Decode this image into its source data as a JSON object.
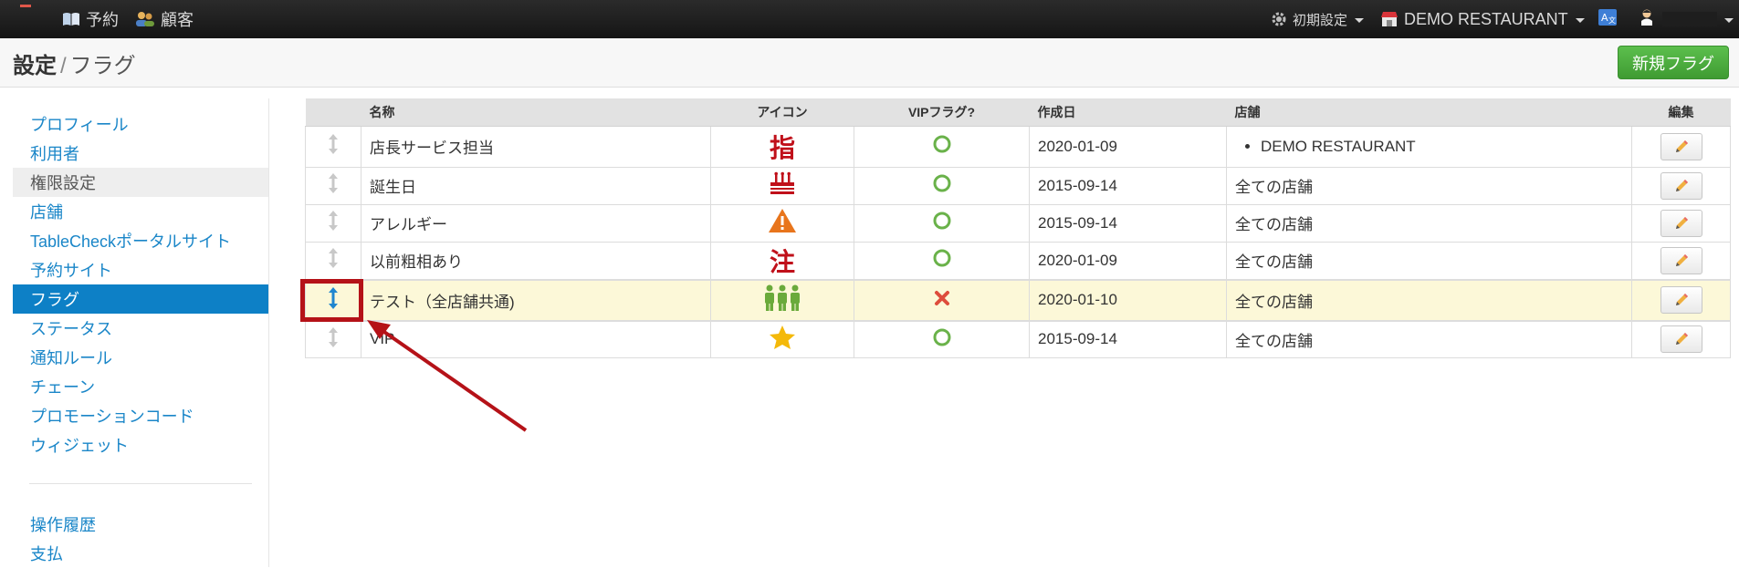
{
  "navbar": {
    "reservations_label": "予約",
    "customers_label": "顧客",
    "settings_label": "初期設定",
    "restaurant_label": "DEMO RESTAURANT"
  },
  "header": {
    "title_main": "設定",
    "title_separator": "/",
    "title_sub": "フラグ",
    "new_flag_label": "新規フラグ"
  },
  "sidebar": {
    "items": [
      {
        "label": "プロフィール"
      },
      {
        "label": "利用者"
      },
      {
        "label": "権限設定"
      },
      {
        "label": "店舗"
      },
      {
        "label": "TableCheckポータルサイト"
      },
      {
        "label": "予約サイト"
      },
      {
        "label": "フラグ"
      },
      {
        "label": "ステータス"
      },
      {
        "label": "通知ルール"
      },
      {
        "label": "チェーン"
      },
      {
        "label": "プロモーションコード"
      },
      {
        "label": "ウィジェット"
      }
    ],
    "bottom_items": [
      {
        "label": "操作履歴"
      },
      {
        "label": "支払"
      }
    ]
  },
  "table": {
    "headers": {
      "name": "名称",
      "icon": "アイコン",
      "vip": "VIPフラグ?",
      "created": "作成日",
      "store": "店舗",
      "edit": "編集"
    },
    "rows": [
      {
        "name": "店長サービス担当",
        "icon": "指",
        "vip": "yes",
        "created": "2020-01-09",
        "store": "DEMO RESTAURANT"
      },
      {
        "name": "誕生日",
        "icon": "cake-icon",
        "vip": "yes",
        "created": "2015-09-14",
        "store": "全ての店舗"
      },
      {
        "name": "アレルギー",
        "icon": "warning-icon",
        "vip": "yes",
        "created": "2015-09-14",
        "store": "全ての店舗"
      },
      {
        "name": "以前粗相あり",
        "icon": "注",
        "vip": "yes",
        "created": "2020-01-09",
        "store": "全ての店舗"
      },
      {
        "name": "テスト（全店舗共通)",
        "icon": "group-icon",
        "vip": "no",
        "created": "2020-01-10",
        "store": "全ての店舗"
      },
      {
        "name": "VIP",
        "icon": "star-icon",
        "vip": "yes",
        "created": "2015-09-14",
        "store": "全ての店舗"
      }
    ]
  },
  "colors": {
    "link": "#1a86c8",
    "active": "#0d80c6",
    "primary_button": "#4cae3f",
    "annotation": "#b51218"
  }
}
